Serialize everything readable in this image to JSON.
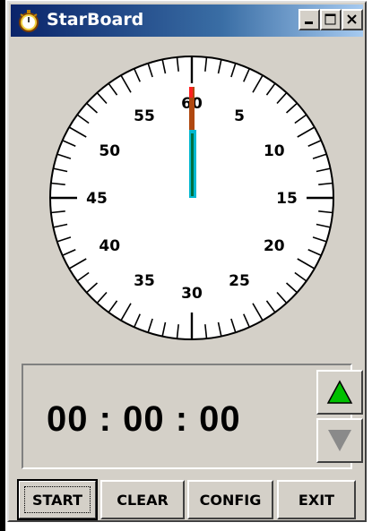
{
  "window": {
    "title": "StarBoard",
    "app_icon": "stopwatch-icon",
    "caption_buttons": [
      "minimize-icon",
      "maximize-icon",
      "close-icon"
    ]
  },
  "dial": {
    "labels": [
      "60",
      "5",
      "10",
      "15",
      "20",
      "25",
      "30",
      "35",
      "40",
      "45",
      "50",
      "55"
    ],
    "hand_value_seconds": 0,
    "colors": {
      "face": "#ffffff",
      "ticks": "#000000",
      "minute_hand": "#c04000",
      "second_hand": "#00b0c8",
      "marker": "#ff2020"
    }
  },
  "timer": {
    "hours": "00",
    "minutes": "00",
    "seconds": "00",
    "separator": ":"
  },
  "controls": {
    "up_icon": "triangle-up-icon",
    "down_icon": "triangle-down-icon",
    "up_color": "#00c000",
    "down_color": "#808080"
  },
  "buttons": {
    "start": "START",
    "clear": "CLEAR",
    "config": "CONFIG",
    "exit": "EXIT"
  }
}
